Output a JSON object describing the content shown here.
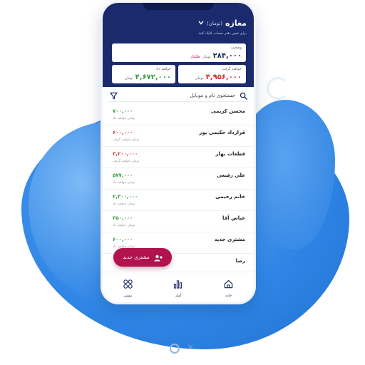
{
  "header": {
    "store_title": "مغازه",
    "store_unit": "(تومان)",
    "hint": "برای تغییر دفتر حساب کلیک کنید"
  },
  "status_card": {
    "label": "وضعیت",
    "value": "۲۸۴,۰۰۰",
    "unit": "تومان",
    "tag": "طلبکار"
  },
  "receivable_card": {
    "label": "خواهید گرفت",
    "value": "۴,۹۵۶,۰۰۰",
    "unit": "تومان"
  },
  "payable_card": {
    "label": "خواهید داد",
    "value": "۴,۶۷۲,۰۰۰",
    "unit": "تومان"
  },
  "search": {
    "placeholder": "جستجوی نام و موبایل"
  },
  "customers": [
    {
      "name": "محسن کریمی",
      "amount": "۷۰۰,۰۰۰",
      "note": "تومان خواهید داد"
    },
    {
      "name": "قرارداد حکیمی پور",
      "amount": "۶۰۰,۰۰۰",
      "note": "تومان خواهید گرفت"
    },
    {
      "name": "قطعات بهار",
      "amount": "۳,۲۰۰,۰۰۰",
      "note": "تومان خواهید گرفت"
    },
    {
      "name": "علی رفیعی",
      "amount": "۵۷۷,۰۰۰",
      "note": "تومان خواهید داد"
    },
    {
      "name": "خانم رحیمی",
      "amount": "۲,۳۰۰,۰۰۰",
      "note": "تومان خواهید داد"
    },
    {
      "name": "عباس آقا",
      "amount": "۳۵۰,۰۰۰",
      "note": "تومان خواهید داد"
    },
    {
      "name": "مشتری جدید",
      "amount": "۶۰۰,۰۰۰",
      "note": "تومان خواهید داد"
    },
    {
      "name": "رضا",
      "amount": "",
      "note": ""
    }
  ],
  "fab": {
    "label": "مشتری جدید"
  },
  "nav": {
    "home": "خانه",
    "reports": "آمار",
    "more": "بیشتر"
  },
  "colors": {
    "header": "#1a2a6c",
    "accent": "#b0134e",
    "positive": "#2e9e3f",
    "negative": "#d32f2f"
  },
  "icons": [
    "chevron-down-icon",
    "search-icon",
    "filter-icon",
    "add-user-icon",
    "home-icon",
    "chart-icon",
    "grid-icon"
  ]
}
